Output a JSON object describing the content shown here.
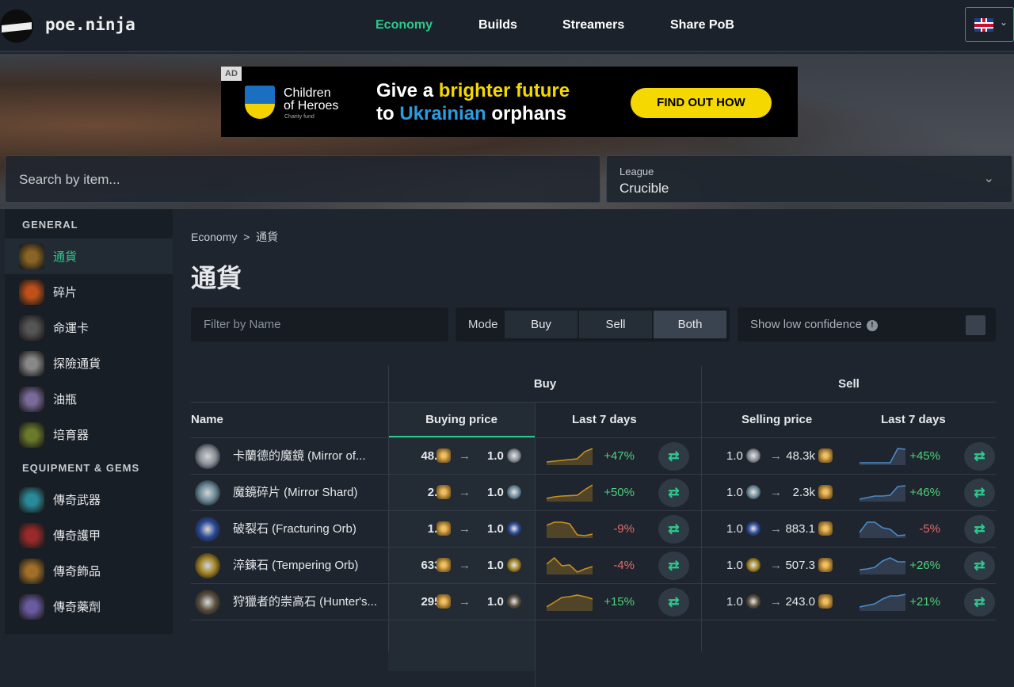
{
  "header": {
    "brand": "poe.ninja",
    "nav": [
      "Economy",
      "Builds",
      "Streamers",
      "Share PoB"
    ],
    "active_nav": "Economy",
    "accent": "#2dc98a"
  },
  "ad": {
    "tag": "AD",
    "org_line1": "Children",
    "org_line2": "of Heroes",
    "org_sub": "Charity fund",
    "headline_a": "Give a ",
    "headline_b": "brighter future",
    "headline_c": "to ",
    "headline_d": "Ukrainian",
    "headline_e": " orphans",
    "cta": "FIND OUT HOW"
  },
  "search": {
    "placeholder": "Search by item..."
  },
  "league": {
    "label": "League",
    "value": "Crucible"
  },
  "sidebar": {
    "sections": [
      {
        "title": "GENERAL",
        "items": [
          {
            "label": "通貨",
            "active": true,
            "color": "#8a6424"
          },
          {
            "label": "碎片",
            "color": "#c0501a"
          },
          {
            "label": "命運卡",
            "color": "#555"
          },
          {
            "label": "探險通貨",
            "color": "#888"
          },
          {
            "label": "油瓶",
            "color": "#7a6a9a"
          },
          {
            "label": "培育器",
            "color": "#6a7a2a"
          }
        ]
      },
      {
        "title": "EQUIPMENT & GEMS",
        "items": [
          {
            "label": "傳奇武器",
            "color": "#2a8a9a"
          },
          {
            "label": "傳奇護甲",
            "color": "#9a2a2a"
          },
          {
            "label": "傳奇飾品",
            "color": "#a0702a"
          },
          {
            "label": "傳奇藥劑",
            "color": "#6a5aa0"
          }
        ]
      }
    ]
  },
  "main": {
    "breadcrumb": {
      "root": "Economy",
      "sep": ">",
      "current": "通貨"
    },
    "title": "通貨",
    "filter_placeholder": "Filter by Name",
    "mode": {
      "label": "Mode",
      "options": [
        "Buy",
        "Sell",
        "Both"
      ],
      "selected": "Both"
    },
    "low_confidence": "Show low confidence",
    "help": "!"
  },
  "table": {
    "groups": {
      "buy": "Buy",
      "sell": "Sell"
    },
    "columns": {
      "name": "Name",
      "buying": "Buying price",
      "buy7": "Last 7 days",
      "selling": "Selling price",
      "sell7": "Last 7 days"
    },
    "unit": "1.0",
    "arrow": "→",
    "swap": "⇄",
    "rows": [
      {
        "name": "卡蘭德的魔鏡 (Mirror of...",
        "color": "#8a8f9a",
        "buy": "48.5k",
        "buy_change": "+47%",
        "buy_spark": [
          0.15,
          0.2,
          0.25,
          0.3,
          0.35,
          0.8,
          1
        ],
        "sell": "48.3k",
        "sell_change": "+45%",
        "sell_spark": [
          0.1,
          0.1,
          0.1,
          0.1,
          0.1,
          1,
          0.95
        ]
      },
      {
        "name": "魔鏡碎片 (Mirror Shard)",
        "color": "#6a8a9a",
        "buy": "2.5k",
        "buy_change": "+50%",
        "buy_spark": [
          0.15,
          0.25,
          0.3,
          0.32,
          0.35,
          0.7,
          1
        ],
        "sell": "2.3k",
        "sell_change": "+46%",
        "sell_spark": [
          0.1,
          0.2,
          0.3,
          0.3,
          0.35,
          0.9,
          0.95
        ]
      },
      {
        "name": "破裂石 (Fracturing Orb)",
        "color": "#2a4a9a",
        "buy": "1.0k",
        "buy_change": "-9%",
        "buy_spark": [
          0.75,
          0.95,
          0.95,
          0.85,
          0.15,
          0.1,
          0.2
        ],
        "sell": "883.1",
        "sell_change": "-5%",
        "sell_spark": [
          0.3,
          0.95,
          0.95,
          0.6,
          0.5,
          0.1,
          0.15
        ]
      },
      {
        "name": "淬鍊石 (Tempering Orb)",
        "color": "#a08020",
        "buy": "633.0",
        "buy_change": "-4%",
        "buy_spark": [
          0.6,
          1,
          0.5,
          0.55,
          0.1,
          0.3,
          0.45
        ],
        "sell": "507.3",
        "sell_change": "+26%",
        "sell_spark": [
          0.25,
          0.3,
          0.4,
          0.8,
          1,
          0.75,
          0.75
        ]
      },
      {
        "name": "狩獵者的崇高石 (Hunter's...",
        "color": "#5a5040",
        "buy": "295.4",
        "buy_change": "+15%",
        "buy_spark": [
          0.2,
          0.5,
          0.8,
          0.85,
          0.95,
          0.85,
          0.7
        ],
        "sell": "243.0",
        "sell_change": "+21%",
        "sell_spark": [
          0.2,
          0.3,
          0.4,
          0.7,
          0.9,
          0.9,
          1
        ]
      }
    ]
  }
}
